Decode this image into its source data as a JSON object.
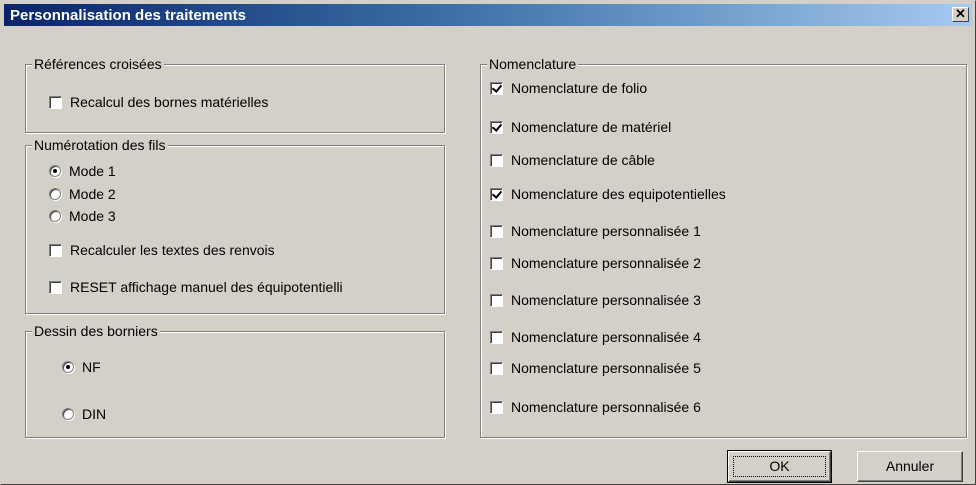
{
  "window": {
    "title": "Personnalisation des traitements",
    "close_glyph": "✕"
  },
  "references": {
    "legend": "Références croisées",
    "recalcul_label": "Recalcul des bornes matérielles",
    "recalcul_checked": false
  },
  "numerotation": {
    "legend": "Numérotation des fils",
    "modes": [
      {
        "label": "Mode 1",
        "selected": true
      },
      {
        "label": "Mode 2",
        "selected": false
      },
      {
        "label": "Mode 3",
        "selected": false
      }
    ],
    "recalculer_label": "Recalculer les textes des renvois",
    "recalculer_checked": false,
    "reset_label": "RESET affichage manuel des équipotentielli",
    "reset_checked": false
  },
  "borniers": {
    "legend": "Dessin des borniers",
    "options": [
      {
        "label": "NF",
        "selected": true
      },
      {
        "label": "DIN",
        "selected": false
      }
    ]
  },
  "nomenclature": {
    "legend": "Nomenclature",
    "items": [
      {
        "label": "Nomenclature de folio",
        "checked": true
      },
      {
        "label": "Nomenclature de matériel",
        "checked": true
      },
      {
        "label": "Nomenclature de câble",
        "checked": false
      },
      {
        "label": "Nomenclature des equipotentielles",
        "checked": true
      },
      {
        "label": "Nomenclature personnalisée 1",
        "checked": false
      },
      {
        "label": "Nomenclature personnalisée 2",
        "checked": false
      },
      {
        "label": "Nomenclature personnalisée 3",
        "checked": false
      },
      {
        "label": "Nomenclature personnalisée 4",
        "checked": false
      },
      {
        "label": "Nomenclature personnalisée 5",
        "checked": false
      },
      {
        "label": "Nomenclature personnalisée 6",
        "checked": false
      }
    ]
  },
  "buttons": {
    "ok": "OK",
    "cancel": "Annuler"
  }
}
